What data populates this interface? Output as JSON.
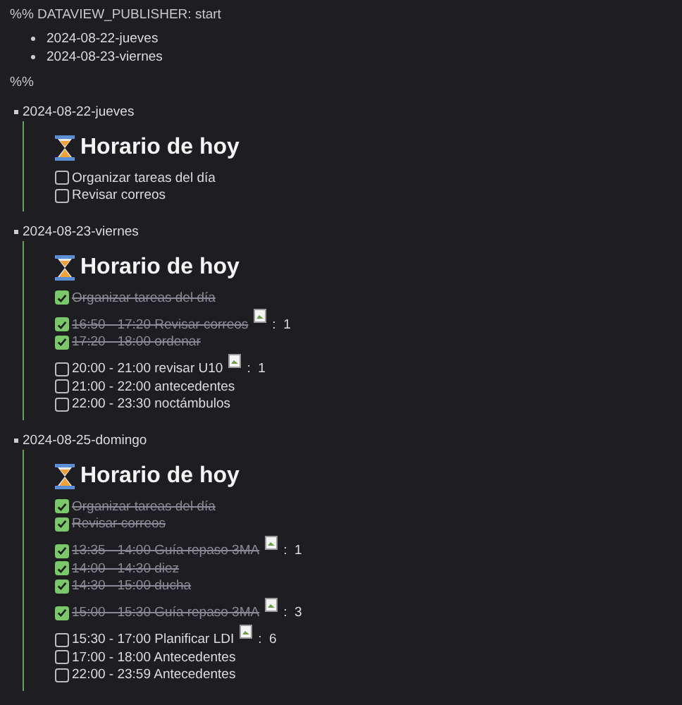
{
  "header": {
    "text": "%% DATAVIEW_PUBLISHER: start"
  },
  "links": [
    "2024-08-22-jueves",
    "2024-08-23-viernes"
  ],
  "footer_marker": "%%",
  "sections": [
    {
      "date": "2024-08-22-jueves",
      "title": "Horario de hoy",
      "tasks": [
        {
          "text": "Organizar tareas del día",
          "checked": false
        },
        {
          "text": "Revisar correos",
          "checked": false
        }
      ]
    },
    {
      "date": "2024-08-23-viernes",
      "title": "Horario de hoy",
      "tasks": [
        {
          "text": "Organizar tareas del día",
          "checked": true
        },
        {
          "text": "16:50 - 17:20 Revisar correos",
          "checked": true,
          "count": ":  1"
        },
        {
          "text": "17:20 - 18:00 ordenar",
          "checked": true
        },
        {
          "text": "20:00 - 21:00 revisar U10",
          "checked": false,
          "count": ":  1"
        },
        {
          "text": "21:00 - 22:00 antecedentes",
          "checked": false
        },
        {
          "text": "22:00 - 23:30 noctámbulos",
          "checked": false
        }
      ]
    },
    {
      "date": "2024-08-25-domingo",
      "title": "Horario de hoy",
      "tasks": [
        {
          "text": "Organizar tareas del día",
          "checked": true
        },
        {
          "text": "Revisar correos",
          "checked": true
        },
        {
          "text": "13:35 - 14:00 Guía repaso 3MA",
          "checked": true,
          "count": ":  1"
        },
        {
          "text": "14:00 - 14:30 diez",
          "checked": true
        },
        {
          "text": "14:30 - 15:00 ducha",
          "checked": true
        },
        {
          "text": "15:00 - 15:30 Guía repaso 3MA",
          "checked": true,
          "count": ":  3"
        },
        {
          "text": "15:30 - 17:00 Planificar LDI",
          "checked": false,
          "count": ":  6"
        },
        {
          "text": "17:00 - 18:00 Antecedentes",
          "checked": false
        },
        {
          "text": "22:00 - 23:59 Antecedentes",
          "checked": false
        }
      ]
    }
  ]
}
